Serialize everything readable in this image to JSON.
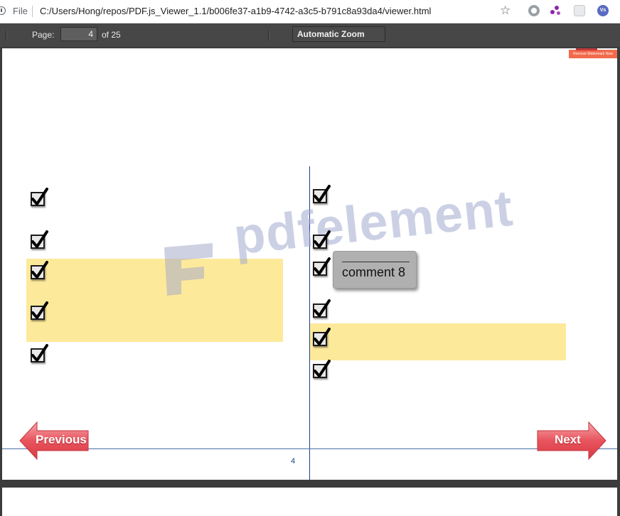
{
  "browser": {
    "scheme_label": "File",
    "url": "C:/Users/Hong/repos/PDF.js_Viewer_1.1/b006fe37-a1b9-4742-a3c5-b791c8a93da4/viewer.html",
    "extensions": [
      "gear-extension-icon",
      "molecule-extension-icon",
      "blank-extension-icon",
      "vs-extension-icon"
    ]
  },
  "toolbar": {
    "page_label": "Page:",
    "page_value": "4",
    "page_of": "of 25",
    "zoom": "Automatic Zoom"
  },
  "document": {
    "watermark_text": "pdfelement",
    "watermark_badge": "Remove Watermark Now",
    "comment": "comment 8",
    "prev_label": "Previous",
    "next_label": "Next",
    "page_number": "4",
    "highlight_color": "#fde99a",
    "button_color": "#e8545d"
  }
}
